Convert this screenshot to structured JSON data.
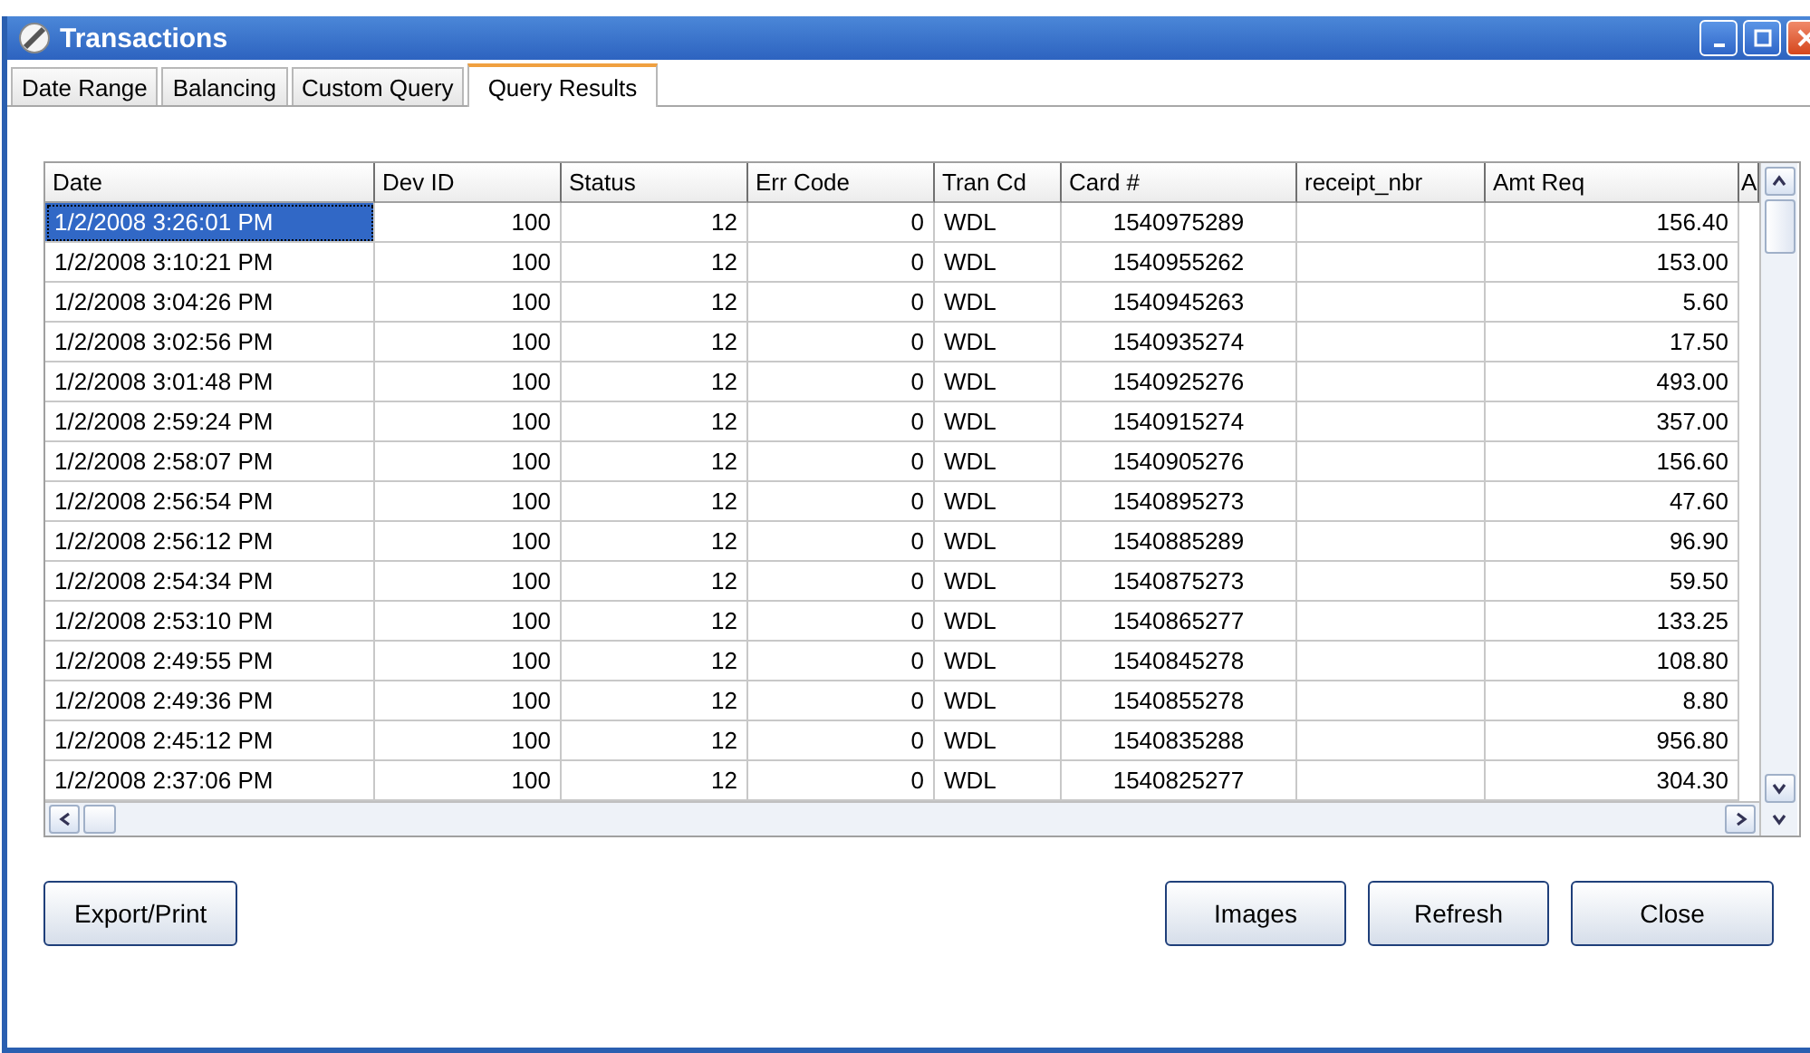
{
  "window": {
    "title": "Transactions"
  },
  "tabs": [
    {
      "label": "Date Range",
      "selected": false
    },
    {
      "label": "Balancing",
      "selected": false
    },
    {
      "label": "Custom Query",
      "selected": false
    },
    {
      "label": "Query Results",
      "selected": true
    }
  ],
  "table": {
    "columns": [
      {
        "label": "Date"
      },
      {
        "label": "Dev ID"
      },
      {
        "label": "Status"
      },
      {
        "label": "Err Code"
      },
      {
        "label": "Tran Cd"
      },
      {
        "label": "Card #"
      },
      {
        "label": "receipt_nbr"
      },
      {
        "label": "Amt Req"
      },
      {
        "label": "A"
      }
    ],
    "rows": [
      {
        "cells": [
          "1/2/2008 3:26:01 PM",
          "100",
          "12",
          "0",
          "WDL",
          "1540975289",
          "",
          "156.40"
        ],
        "selected": true
      },
      {
        "cells": [
          "1/2/2008 3:10:21 PM",
          "100",
          "12",
          "0",
          "WDL",
          "1540955262",
          "",
          "153.00"
        ],
        "selected": false
      },
      {
        "cells": [
          "1/2/2008 3:04:26 PM",
          "100",
          "12",
          "0",
          "WDL",
          "1540945263",
          "",
          "5.60"
        ],
        "selected": false
      },
      {
        "cells": [
          "1/2/2008 3:02:56 PM",
          "100",
          "12",
          "0",
          "WDL",
          "1540935274",
          "",
          "17.50"
        ],
        "selected": false
      },
      {
        "cells": [
          "1/2/2008 3:01:48 PM",
          "100",
          "12",
          "0",
          "WDL",
          "1540925276",
          "",
          "493.00"
        ],
        "selected": false
      },
      {
        "cells": [
          "1/2/2008 2:59:24 PM",
          "100",
          "12",
          "0",
          "WDL",
          "1540915274",
          "",
          "357.00"
        ],
        "selected": false
      },
      {
        "cells": [
          "1/2/2008 2:58:07 PM",
          "100",
          "12",
          "0",
          "WDL",
          "1540905276",
          "",
          "156.60"
        ],
        "selected": false
      },
      {
        "cells": [
          "1/2/2008 2:56:54 PM",
          "100",
          "12",
          "0",
          "WDL",
          "1540895273",
          "",
          "47.60"
        ],
        "selected": false
      },
      {
        "cells": [
          "1/2/2008 2:56:12 PM",
          "100",
          "12",
          "0",
          "WDL",
          "1540885289",
          "",
          "96.90"
        ],
        "selected": false
      },
      {
        "cells": [
          "1/2/2008 2:54:34 PM",
          "100",
          "12",
          "0",
          "WDL",
          "1540875273",
          "",
          "59.50"
        ],
        "selected": false
      },
      {
        "cells": [
          "1/2/2008 2:53:10 PM",
          "100",
          "12",
          "0",
          "WDL",
          "1540865277",
          "",
          "133.25"
        ],
        "selected": false
      },
      {
        "cells": [
          "1/2/2008 2:49:55 PM",
          "100",
          "12",
          "0",
          "WDL",
          "1540845278",
          "",
          "108.80"
        ],
        "selected": false
      },
      {
        "cells": [
          "1/2/2008 2:49:36 PM",
          "100",
          "12",
          "0",
          "WDL",
          "1540855278",
          "",
          "8.80"
        ],
        "selected": false
      },
      {
        "cells": [
          "1/2/2008 2:45:12 PM",
          "100",
          "12",
          "0",
          "WDL",
          "1540835288",
          "",
          "956.80"
        ],
        "selected": false
      },
      {
        "cells": [
          "1/2/2008 2:37:06 PM",
          "100",
          "12",
          "0",
          "WDL",
          "1540825277",
          "",
          "304.30"
        ],
        "selected": false
      }
    ]
  },
  "buttons_left": [
    "Export/Print"
  ],
  "buttons_right": [
    "Images",
    "Refresh",
    "Close"
  ]
}
